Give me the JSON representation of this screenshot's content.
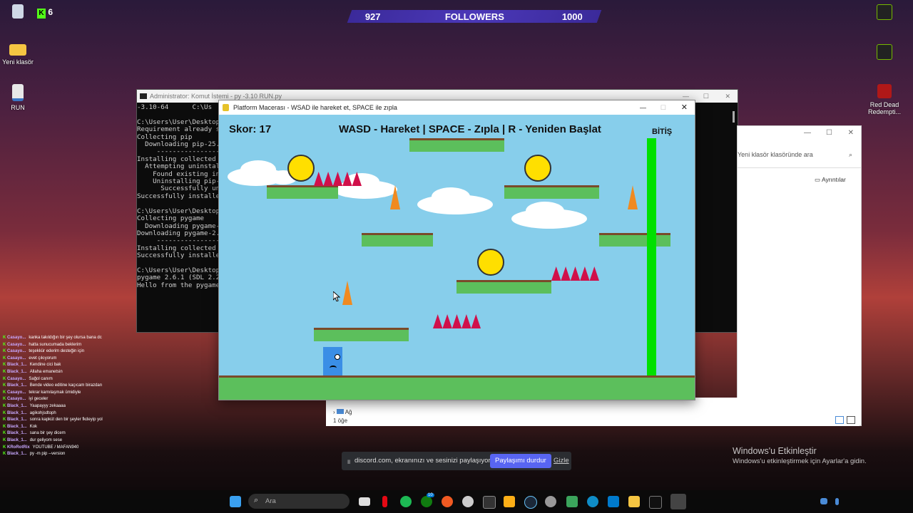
{
  "desktop": {
    "icons": [
      {
        "label": ""
      },
      {
        "label": "Yeni klasör"
      },
      {
        "label": "RUN"
      },
      {
        "label": "Red Dead Redempti..."
      }
    ],
    "kick_count": "6"
  },
  "followers": {
    "current": "927",
    "label": "FOLLOWERS",
    "goal": "1000"
  },
  "cmd": {
    "title": "Administrator: Komut İstemi - py  -3.10 RUN.py",
    "lines": "-3.10-64      C:\\Us\n\nC:\\Users\\User\\Desktop>\nRequirement already sa\nCollecting pip\n  Downloading pip-25.3\n     ----------------\nInstalling collected p\n  Attempting uninstall\n    Found existing ins\n    Uninstalling pip-2\n      Successfully uni\nSuccessfully installed\n\nC:\\Users\\User\\Desktop>\nCollecting pygame\n  Downloading pygame-2\nDownloading pygame-2.6\n     ----------------\nInstalling collected p\nSuccessfully installed\n\nC:\\Users\\User\\Desktop>\npygame 2.6.1 (SDL 2.28\nHello from the pygame"
  },
  "explorer": {
    "search_placeholder": "Yeni klasör klasöründe ara",
    "details": "Ayrıntılar",
    "tree_item": "Ağ",
    "status": "1 öğe"
  },
  "game": {
    "title": "Platform Macerası - WSAD ile hareket et, SPACE ile zıpla",
    "score": "Skor: 17",
    "instructions": "WASD - Hareket | SPACE - Zıpla | R - Yeniden Başlat",
    "finish": "BİTİŞ",
    "colors": {
      "sky": "#87ceeb",
      "grass": "#5cbf5c",
      "spike": "#d0104a",
      "finish": "#00e000",
      "player": "#3a8ee6"
    }
  },
  "chat": [
    {
      "user": "Casayo...",
      "msg": "kanka takıldığın bir şey olursa bana dc üzerinden ulaşabilirsin"
    },
    {
      "user": "Casayo...",
      "msg": "hatta sunucumada beklerim"
    },
    {
      "user": "Casayo...",
      "msg": "teşekkür ederim desteğin için"
    },
    {
      "user": "Casayo...",
      "msg": "evet çıkıyorum"
    },
    {
      "user": "Black_1...",
      "msg": "Kendine cici bak"
    },
    {
      "user": "Black_1...",
      "msg": "Allaha emanetsin"
    },
    {
      "user": "Casayo...",
      "msg": "Sağol canım"
    },
    {
      "user": "Black_1...",
      "msg": "Bende video editine kaçıcam birazdan"
    },
    {
      "user": "Casayo...",
      "msg": "tekrar karnılaşmak ümidiyle"
    },
    {
      "user": "Casayo...",
      "msg": "iyi geceler"
    },
    {
      "user": "Black_1...",
      "msg": "Yaapayyy zekaaaa"
    },
    {
      "user": "Black_1...",
      "msg": "agikohjsdtoph"
    },
    {
      "user": "Black_1...",
      "msg": "sonra kapküt den bir şeyler fkdeyip yollicam"
    },
    {
      "user": "Black_1...",
      "msg": "Kok"
    },
    {
      "user": "Black_1...",
      "msg": "sana bir şey dicem"
    },
    {
      "user": "Black_1...",
      "msg": "dur geliyom sese"
    },
    {
      "user": "KRoRotRix",
      "msg": "YOUTUBE / MAFAN940"
    },
    {
      "user": "Black_1...",
      "msg": "py -m pip --version"
    }
  ],
  "share": {
    "text": "discord.com, ekranınızı ve sesinizi paylaşıyor.",
    "stop": "Paylaşımı durdur",
    "hide": "Gizle"
  },
  "activation": {
    "title": "Windows'u Etkinleştir",
    "subtitle": "Windows'u etkinleştirmek için Ayarlar'a gidin."
  },
  "taskbar": {
    "search_placeholder": "Ara",
    "badge": "10"
  }
}
